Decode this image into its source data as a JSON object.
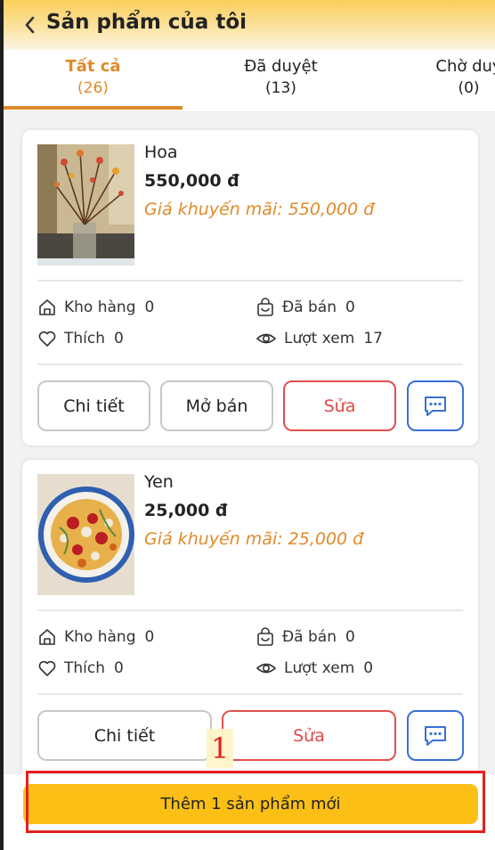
{
  "header": {
    "title": "Sản phẩm của tôi",
    "back_icon": "chevron-left-icon"
  },
  "tabs": [
    {
      "label": "Tất cả",
      "count": "(26)",
      "active": true
    },
    {
      "label": "Đã duyệt",
      "count": "(13)",
      "active": false
    },
    {
      "label": "Chờ duy",
      "count": "(0)",
      "active": false
    }
  ],
  "products": [
    {
      "name": "Hoa",
      "price": "550,000 đ",
      "promo": "Giá khuyến mãi: 550,000 đ",
      "stats": {
        "stock_label": "Kho hàng",
        "stock": "0",
        "sold_label": "Đã bán",
        "sold": "0",
        "likes_label": "Thích",
        "likes": "0",
        "views_label": "Lượt xem",
        "views": "17"
      },
      "buttons": {
        "detail": "Chi tiết",
        "open_sale": "Mở bán",
        "edit": "Sửa"
      }
    },
    {
      "name": "Yen",
      "price": "25,000 đ",
      "promo": "Giá khuyến mãi: 25,000 đ",
      "stats": {
        "stock_label": "Kho hàng",
        "stock": "0",
        "sold_label": "Đã bán",
        "sold": "0",
        "likes_label": "Thích",
        "likes": "0",
        "views_label": "Lượt xem",
        "views": "0"
      },
      "buttons": {
        "detail": "Chi tiết",
        "edit": "Sửa"
      }
    }
  ],
  "footer": {
    "add_button": "Thêm 1 sản phẩm mới"
  },
  "annotation": {
    "number": "1"
  },
  "colors": {
    "accent": "#e08a2a",
    "primary_button": "#fbbf16",
    "edit": "#e04848",
    "chat": "#3a6fd6",
    "highlight": "#e4201e"
  }
}
